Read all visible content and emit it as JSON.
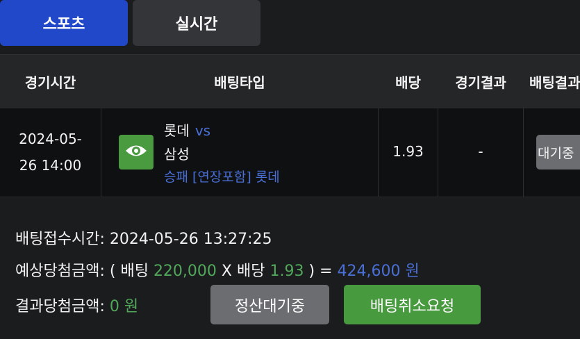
{
  "tabs": {
    "sports": "스포츠",
    "live": "실시간"
  },
  "table": {
    "headers": [
      "경기시간",
      "배팅타입",
      "배당",
      "경기결과",
      "배팅결과"
    ],
    "row": {
      "date": "2024-05-",
      "time": "26 14:00",
      "home_team": "롯데",
      "vs": "vs",
      "away_team": "삼성",
      "bet_type": "승패 [연장포함] 롯데",
      "odds": "1.93",
      "result": "-",
      "status": "대기중",
      "view_icon": "eye-icon"
    }
  },
  "summary": {
    "bet_time_label": "배팅접수시간:",
    "bet_time_value": "2024-05-26 13:27:25",
    "expected_label": "예상당첨금액:",
    "open_paren": "(",
    "bet_label": "배팅",
    "bet_amount": "220,000",
    "multiply": "X",
    "odds_label": "배당",
    "odds_value": "1.93",
    "close_eq": ") =",
    "expected_amount": "424,600 원",
    "result_label": "결과당첨금액:",
    "result_amount": "0 원"
  },
  "buttons": {
    "pending": "정산대기중",
    "cancel_request": "배팅취소요청"
  },
  "colors": {
    "tab_active": "#2148c9",
    "green": "#52a85a",
    "blue": "#4a6fd6",
    "gray_button": "#6b6d70"
  }
}
